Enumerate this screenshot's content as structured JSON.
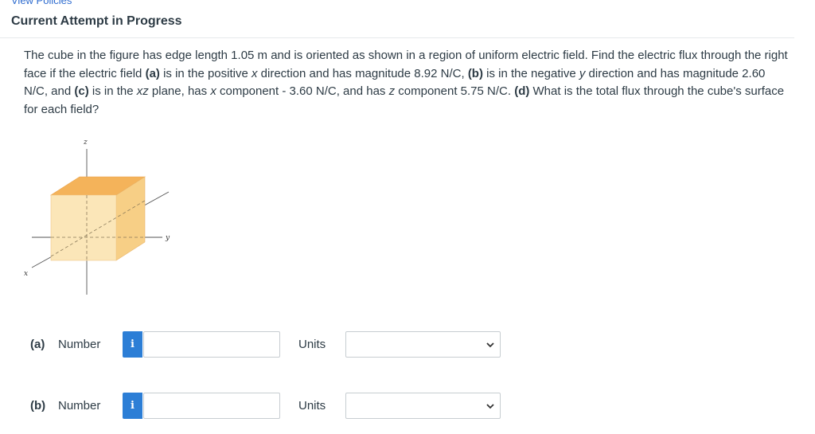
{
  "header": {
    "top_link": "View Policies",
    "title": "Current Attempt in Progress"
  },
  "problem": {
    "s1": "The cube in the figure has edge length 1.05 m and is oriented as shown in a region of uniform electric field. Find the electric flux through the right face if the electric field ",
    "a_tag": "(a)",
    "s2": " is in the positive ",
    "var_x1": "x",
    "s3": " direction and has magnitude 8.92 N/C, ",
    "b_tag": "(b)",
    "s4": " is in the negative ",
    "var_y": "y",
    "s5": " direction and has magnitude 2.60 N/C, and ",
    "c_tag": "(c)",
    "s6": " is in the ",
    "var_xz": "xz",
    "s7": " plane, has ",
    "var_x2": "x",
    "s8": " component - 3.60 N/C, and has ",
    "var_z": "z",
    "s9": " component 5.75 N/C. ",
    "d_tag": "(d)",
    "s10": " What is the total flux through the cube's surface for each field?"
  },
  "figure": {
    "axis_z": "z",
    "axis_y": "y",
    "axis_x": "x"
  },
  "answers": [
    {
      "tag": "(a)",
      "number_label": "Number",
      "info_glyph": "i",
      "value": "",
      "units_label": "Units",
      "units_value": ""
    },
    {
      "tag": "(b)",
      "number_label": "Number",
      "info_glyph": "i",
      "value": "",
      "units_label": "Units",
      "units_value": ""
    }
  ],
  "colors": {
    "accent": "#2c7ed6",
    "text": "#2d3b45",
    "cube_top": "#f4b35a",
    "cube_front": "#fbe6b8",
    "cube_side": "#f7cf86"
  }
}
